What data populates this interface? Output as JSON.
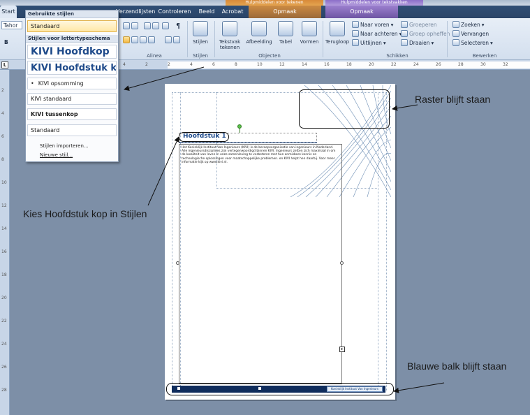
{
  "title_bar": {
    "context_draw": "Hulpmiddelen voor tekenen",
    "context_text": "Hulpmiddelen voor tekstvakken"
  },
  "tabs": [
    {
      "label": "Start"
    },
    {
      "label": "Verzendlijsten"
    },
    {
      "label": "Controleren"
    },
    {
      "label": "Beeld"
    },
    {
      "label": "Acrobat"
    },
    {
      "label": "Opmaak"
    },
    {
      "label": "Opmaak"
    }
  ],
  "ribbon": {
    "groups": {
      "alinea": "Alinea",
      "stijlen": "Stijlen",
      "objecten": "Objecten",
      "schikken": "Schikken",
      "bewerken": "Bewerken"
    },
    "stijlen_button": "Stijlen",
    "tekstvak_tekenen": "Tekstvak tekenen",
    "afbeelding": "Afbeelding",
    "tabel": "Tabel",
    "vormen": "Vormen",
    "terugloop": "Terugloop",
    "naar_voren": "Naar voren",
    "naar_achteren": "Naar achteren",
    "uitlijnen": "Uitlijnen",
    "groeperen": "Groeperen",
    "groep_opheffen": "Groep opheffen",
    "draaien": "Draaien",
    "zoeken": "Zoeken",
    "vervangen": "Vervangen",
    "selecteren": "Selecteren",
    "font_box": "Tahor",
    "bold_b": "B"
  },
  "styles_panel": {
    "header_used": "Gebruikte stijlen",
    "used_item": "Standaard",
    "header_scheme": "Stijlen voor lettertypeschema",
    "items": [
      {
        "label": "KIVI Hoofdkop"
      },
      {
        "label": "KIVI Hoofdstuk kop"
      },
      {
        "label": "KIVI opsomming"
      },
      {
        "label": "KIVI standaard"
      },
      {
        "label": "KIVI tussenkop"
      },
      {
        "label": "Standaard"
      }
    ],
    "import_link": "Stijlen importeren...",
    "new_style_link": "Nieuwe stijl..."
  },
  "page": {
    "heading": "Hoofdstuk 1",
    "body_text": "Het Koninklijk Instituut Van Ingenieurs (KIVI) is de beroepsorganisatie van ingenieurs in Nederland. Alle ingenieursdisciplines zijn vertegenwoordigd binnen KIVI. Ingenieurs zetten zich maximaal in om de kwaliteit van leven in onze samenleving te verbeteren met hun onmisbare kennis en technologische oplossingen voor maatschappelijke problemen. en KIVI helpt hen daarbij. Voor meer informatie kijk op www.kivi.nl.",
    "footer_label": "Koninklijk Instituut Van Ingenieurs"
  },
  "ruler": {
    "h_numbers": [
      "4",
      "2",
      "2",
      "4",
      "6",
      "8",
      "10",
      "12",
      "14",
      "16",
      "18",
      "20",
      "22",
      "24",
      "26",
      "28",
      "30",
      "32"
    ],
    "v_numbers": [
      "2",
      "4",
      "6",
      "8",
      "10",
      "12",
      "14",
      "16",
      "18",
      "20",
      "22",
      "24",
      "26",
      "28"
    ]
  },
  "annotations": {
    "raster": "Raster blijft staan",
    "hoofdstuk": "Kies Hoofdstuk kop in Stijlen",
    "balk": "Blauwe balk blijft staan"
  },
  "colors": {
    "footer_bar": "#0f2c5c",
    "heading_text": "#1e4a8a",
    "highlight": "#ffe8a6"
  }
}
